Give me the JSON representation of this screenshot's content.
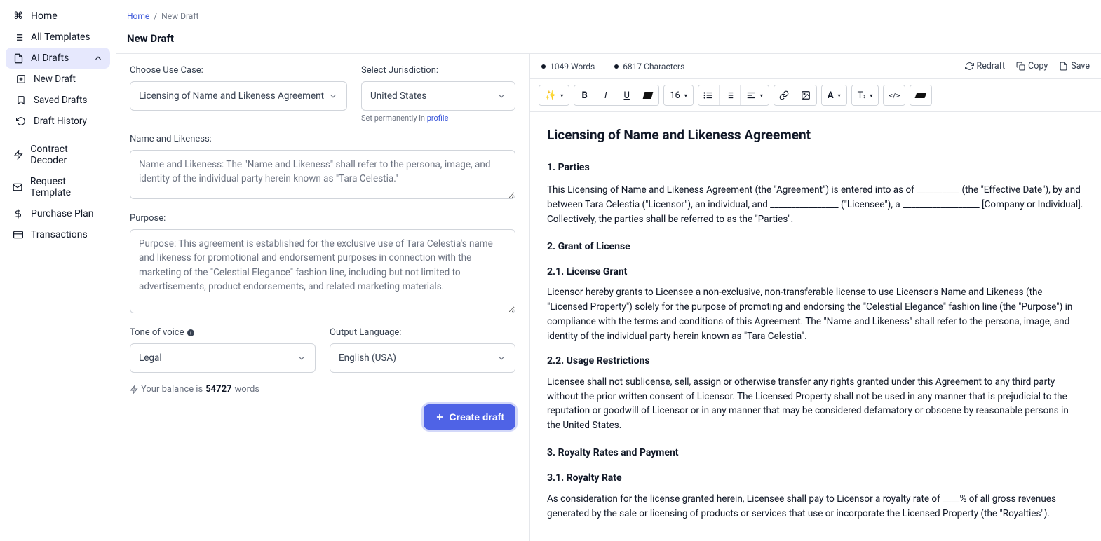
{
  "sidebar": {
    "home": "Home",
    "all_templates": "All Templates",
    "ai_drafts": "AI Drafts",
    "new_draft": "New Draft",
    "saved_drafts": "Saved Drafts",
    "draft_history": "Draft History",
    "contract_decoder": "Contract Decoder",
    "request_template": "Request Template",
    "purchase_plan": "Purchase Plan",
    "transactions": "Transactions"
  },
  "breadcrumb": {
    "home": "Home",
    "sep": "/",
    "current": "New Draft"
  },
  "page_title": "New Draft",
  "form": {
    "use_case_label": "Choose Use Case:",
    "use_case_value": "Licensing of Name and Likeness Agreement",
    "jurisdiction_label": "Select Jurisdiction:",
    "jurisdiction_value": "United States",
    "jurisdiction_hint_prefix": "Set permanently in ",
    "jurisdiction_hint_link": "profile",
    "name_likeness_label": "Name and Likeness:",
    "name_likeness_value": "Name and Likeness: The \"Name and Likeness\" shall refer to the persona, image, and identity of the individual party herein known as \"Tara Celestia.\"",
    "purpose_label": "Purpose:",
    "purpose_value": "Purpose: This agreement is established for the exclusive use of Tara Celestia's name and likeness for promotional and endorsement purposes in connection with the marketing of the \"Celestial Elegance\" fashion line, including but not limited to advertisements, product endorsements, and related marketing materials.",
    "tone_label": "Tone of voice ",
    "tone_value": "Legal",
    "lang_label": "Output Language:",
    "lang_value": "English (USA)",
    "balance_prefix": "Your balance is ",
    "balance_value": "54727",
    "balance_suffix": " words",
    "create_btn": "Create draft"
  },
  "editor": {
    "words": "1049 Words",
    "chars": "6817 Characters",
    "redraft": "Redraft",
    "copy": "Copy",
    "save": "Save",
    "font_size": "16"
  },
  "document": {
    "title": "Licensing of Name and Likeness Agreement",
    "s1_h": "1. Parties",
    "s1_p": "This Licensing of Name and Likeness Agreement (the \"Agreement\") is entered into as of __________ (the \"Effective Date\"), by and between Tara Celestia (\"Licensor\"), an individual, and ________________ (\"Licensee\"), a __________________ [Company or Individual]. Collectively, the parties shall be referred to as the \"Parties\".",
    "s2_h": "2. Grant of License",
    "s21_h": "2.1. License Grant",
    "s21_p": "Licensor hereby grants to Licensee a non-exclusive, non-transferable license to use Licensor's Name and Likeness (the \"Licensed Property\") solely for the purpose of promoting and endorsing the \"Celestial Elegance\" fashion line (the \"Purpose\") in compliance with the terms and conditions of this Agreement. The \"Name and Likeness\" shall refer to the persona, image, and identity of the individual party herein known as \"Tara Celestia\".",
    "s22_h": "2.2. Usage Restrictions",
    "s22_p": "Licensee shall not sublicense, sell, assign or otherwise transfer any rights granted under this Agreement to any third party without the prior written consent of Licensor. The Licensed Property shall not be used in any manner that is prejudicial to the reputation or goodwill of Licensor or in any manner that may be considered defamatory or obscene by reasonable persons in the United States.",
    "s3_h": "3. Royalty Rates and Payment",
    "s31_h": "3.1. Royalty Rate",
    "s31_p": "As consideration for the license granted herein, Licensee shall pay to Licensor a royalty rate of ____% of all gross revenues generated by the sale or licensing of products or services that use or incorporate the Licensed Property (the \"Royalties\")."
  }
}
